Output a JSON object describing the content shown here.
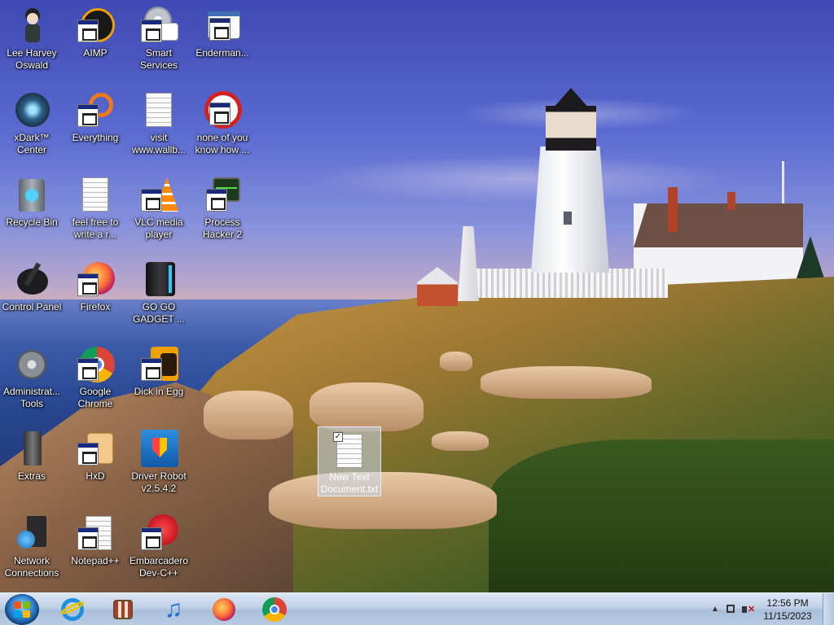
{
  "desktop": {
    "icons": [
      {
        "label": "Lee Harvey Oswald",
        "icon": "anime-character-icon"
      },
      {
        "label": "AIMP",
        "icon": "aimp-icon"
      },
      {
        "label": "Smart Services",
        "icon": "gears-icon"
      },
      {
        "label": "Enderman...",
        "icon": "window-app-icon"
      },
      {
        "label": "xDark™ Center",
        "icon": "dark-orb-icon"
      },
      {
        "label": "Everything",
        "icon": "everything-search-icon"
      },
      {
        "label": "visit www.wallb...",
        "icon": "text-document-icon"
      },
      {
        "label": "none of you know how ...",
        "icon": "red-swirl-icon"
      },
      {
        "label": "Recycle Bin",
        "icon": "recycle-bin-icon"
      },
      {
        "label": "feel free to write a r...",
        "icon": "text-document-icon"
      },
      {
        "label": "VLC media player",
        "icon": "vlc-cone-icon"
      },
      {
        "label": "Process Hacker 2",
        "icon": "process-hacker-icon"
      },
      {
        "label": "Control Panel",
        "icon": "control-panel-icon"
      },
      {
        "label": "Firefox",
        "icon": "firefox-icon"
      },
      {
        "label": "GO GO GADGET ...",
        "icon": "gadget-icon"
      },
      {
        "label": "Administrat... Tools",
        "icon": "admin-tools-icon"
      },
      {
        "label": "Google Chrome",
        "icon": "chrome-icon"
      },
      {
        "label": "Dick in Egg",
        "icon": "dick-in-egg-icon"
      },
      {
        "label": "Extras",
        "icon": "extras-folder-icon"
      },
      {
        "label": "HxD",
        "icon": "hxd-icon"
      },
      {
        "label": "Driver Robot v2.5.4.2",
        "icon": "driver-robot-icon"
      },
      {
        "label": "Network Connections",
        "icon": "network-connections-icon"
      },
      {
        "label": "Notepad++",
        "icon": "notepadpp-icon"
      },
      {
        "label": "Embarcadero Dev-C++",
        "icon": "devcpp-icon"
      },
      {
        "label": "New Text Document.txt",
        "icon": "text-document-icon",
        "selected": true
      }
    ]
  },
  "taskbar": {
    "start_label": "Start",
    "pinned": [
      {
        "name": "Internet Explorer",
        "icon": "internet-explorer-icon"
      },
      {
        "name": "Media Center",
        "icon": "media-center-icon"
      },
      {
        "name": "Music",
        "icon": "music-note-icon"
      },
      {
        "name": "Firefox",
        "icon": "firefox-icon"
      },
      {
        "name": "Google Chrome",
        "icon": "chrome-icon"
      }
    ],
    "tray": {
      "time": "12:56 PM",
      "date": "11/15/2023"
    }
  },
  "colors": {
    "taskbar_top": "#dbe6f3",
    "taskbar_bottom": "#a9bedb",
    "label_text": "#ffffff",
    "selection": "#c8d7eb"
  }
}
